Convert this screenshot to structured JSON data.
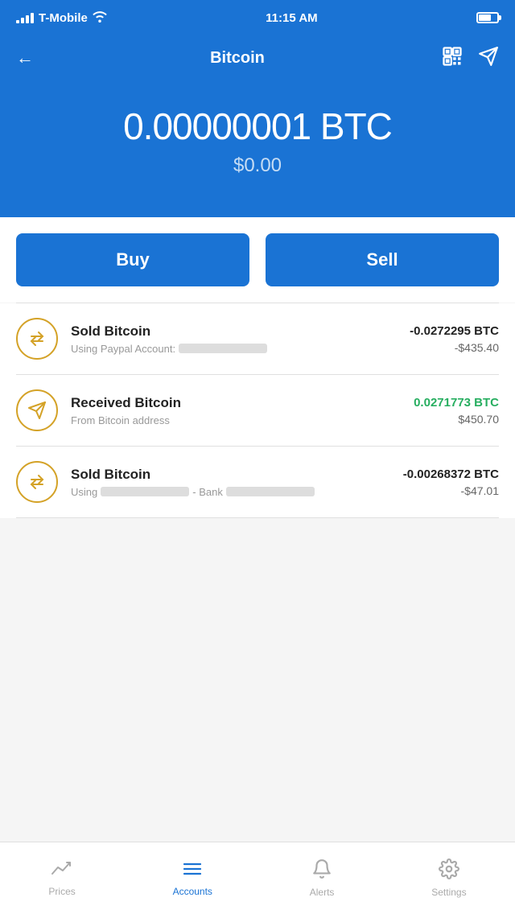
{
  "statusBar": {
    "carrier": "T-Mobile",
    "time": "11:15 AM"
  },
  "navBar": {
    "title": "Bitcoin",
    "backLabel": "←"
  },
  "hero": {
    "btcAmount": "0.00000001 BTC",
    "usdAmount": "$0.00"
  },
  "buttons": {
    "buy": "Buy",
    "sell": "Sell"
  },
  "transactions": [
    {
      "type": "sell",
      "title": "Sold Bitcoin",
      "subtitle_prefix": "Using Paypal Account:",
      "btcAmount": "-0.0272295 BTC",
      "usdAmount": "-$435.40",
      "btcPositive": false
    },
    {
      "type": "receive",
      "title": "Received Bitcoin",
      "subtitle_prefix": "From Bitcoin address",
      "btcAmount": "0.0271773 BTC",
      "usdAmount": "$450.70",
      "btcPositive": true
    },
    {
      "type": "sell",
      "title": "Sold Bitcoin",
      "subtitle_prefix": "Using",
      "subtitle_suffix": "- Bank",
      "btcAmount": "-0.00268372 BTC",
      "usdAmount": "-$47.01",
      "btcPositive": false
    }
  ],
  "tabBar": {
    "items": [
      {
        "label": "Prices",
        "icon": "📈",
        "active": false
      },
      {
        "label": "Accounts",
        "icon": "☰",
        "active": true
      },
      {
        "label": "Alerts",
        "icon": "🔔",
        "active": false
      },
      {
        "label": "Settings",
        "icon": "⚙",
        "active": false
      }
    ]
  }
}
